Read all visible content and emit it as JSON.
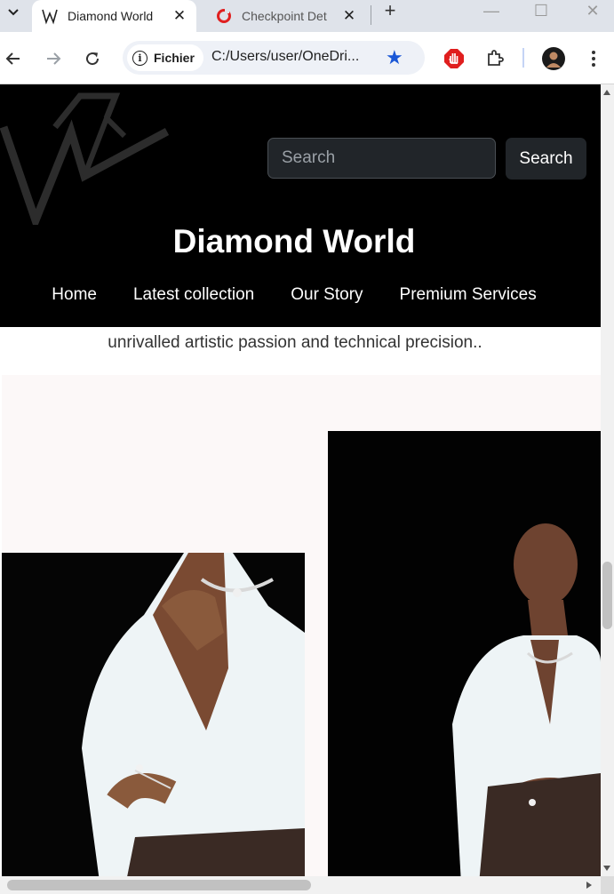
{
  "browser": {
    "tabs": [
      {
        "title": "Diamond World",
        "icon": "w-logo-icon",
        "active": true
      },
      {
        "title": "Checkpoint Det",
        "icon": "checkpoint-icon",
        "active": false
      }
    ],
    "address": {
      "scheme_label": "Fichier",
      "url": "C:/Users/user/OneDri..."
    }
  },
  "site": {
    "search_placeholder": "Search",
    "search_button": "Search",
    "brand": "Diamond World",
    "nav": [
      "Home",
      "Latest collection",
      "Our Story",
      "Premium Services"
    ],
    "tagline": "unrivalled artistic passion and technical precision.."
  },
  "colors": {
    "header_bg": "#000000",
    "accent_star": "#1a57d6",
    "button_bg": "#212529"
  }
}
